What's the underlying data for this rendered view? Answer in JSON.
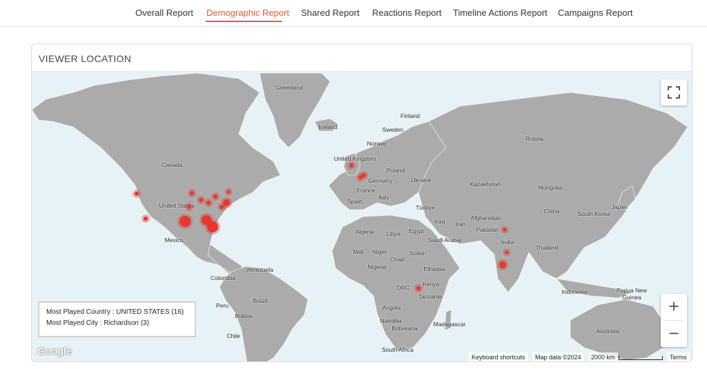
{
  "nav": {
    "tabs": [
      {
        "label": "Overall Report",
        "active": false
      },
      {
        "label": "Demographic Report",
        "active": true
      },
      {
        "label": "Shared Report",
        "active": false
      },
      {
        "label": "Reactions Report",
        "active": false
      },
      {
        "label": "Timeline Actions Report",
        "active": false
      },
      {
        "label": "Campaigns Report",
        "active": false
      }
    ]
  },
  "card": {
    "title": "VIEWER LOCATION"
  },
  "map": {
    "labels": {
      "greenland": "Greenland",
      "iceland": "Iceland",
      "finland": "Finland",
      "sweden": "Sweden",
      "norway": "Norway",
      "russia": "Russia",
      "united_kingdom": "United Kingdom",
      "poland": "Poland",
      "germany": "Germany",
      "ukraine": "Ukraine",
      "france": "France",
      "kazakhstan": "Kazakhstan",
      "mongolia": "Mongolia",
      "italy": "Italy",
      "spain": "Spain",
      "turkiye": "Türkiye",
      "china": "China",
      "japan": "Japan",
      "south_korea": "South Korea",
      "afghanistan": "Afghanistan",
      "iraq": "Iraq",
      "iran": "Iran",
      "pakistan": "Pakistan",
      "algeria": "Algeria",
      "libya": "Libya",
      "egypt": "Egypt",
      "saudi_arabia": "Saudi Arabia",
      "india": "India",
      "thailand": "Thailand",
      "mali": "Mali",
      "niger": "Niger",
      "sudan": "Sudan",
      "chad": "Chad",
      "nigeria": "Nigeria",
      "ethiopia": "Ethiopia",
      "kenya": "Kenya",
      "drc": "DRC",
      "tanzania": "Tanzania",
      "indonesia": "Indonesia",
      "papua_new_guinea": "Papua New Guinea",
      "angola": "Angola",
      "namibia": "Namibia",
      "madagascar": "Madagascar",
      "botswana": "Botswana",
      "south_africa": "South Africa",
      "australia": "Australia",
      "canada": "Canada",
      "united_states": "United States",
      "mexico": "Mexico",
      "venezuela": "Venezuela",
      "colombia": "Colombia",
      "peru": "Peru",
      "brazil": "Brazil",
      "bolivia": "Bolivia",
      "chile": "Chile"
    },
    "summary": {
      "most_played_country": "Most Played Country : UNITED STATES (16)",
      "most_played_city": "Most Played City : Richardson (3)"
    },
    "controls": {
      "zoom_in": "+",
      "zoom_out": "−"
    },
    "attribution": {
      "logo": "Google",
      "keyboard_shortcuts": "Keyboard shortcuts",
      "map_data": "Map data ©2024",
      "scale": "2000 km",
      "terms": "Terms"
    }
  },
  "colors": {
    "accent": "#e8573f",
    "marker": "#e5392f",
    "land": "#ababab",
    "water": "#e7f2f7"
  }
}
